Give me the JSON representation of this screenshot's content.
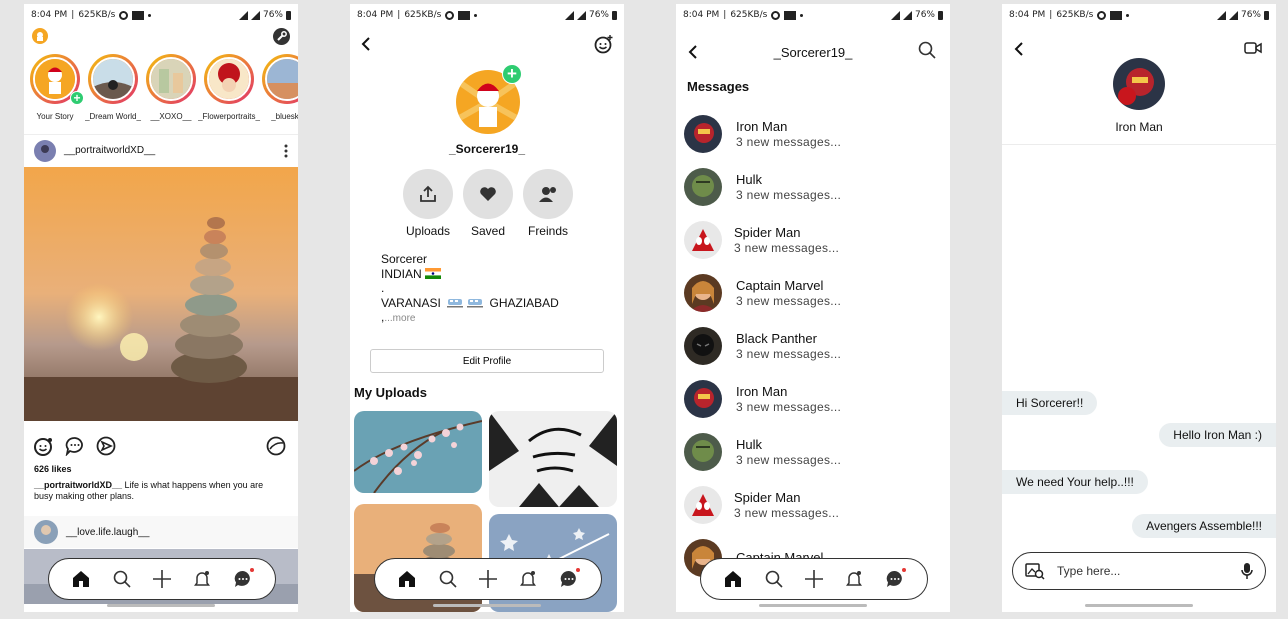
{
  "status_bar": {
    "time": "8:04 PM",
    "speed": "625KB/s",
    "battery": "76%"
  },
  "feed": {
    "stories": [
      {
        "name": "Your Story",
        "has_add": true
      },
      {
        "name": "_Dream World_"
      },
      {
        "name": "__XOXO__"
      },
      {
        "name": "_Flowerportraits_"
      },
      {
        "name": "_bluesky"
      }
    ],
    "post": {
      "username": "__portraitworldXD__",
      "likes": "626 likes",
      "caption_user": "__portraitworldXD__",
      "caption_text": " Life is what happens when you are busy making other plans."
    },
    "post2": {
      "username": "__love.life.laugh__"
    }
  },
  "profile": {
    "username": "_Sorcerer19_",
    "buttons": [
      {
        "label": "Uploads",
        "icon": "upload-icon"
      },
      {
        "label": "Saved",
        "icon": "heart-icon"
      },
      {
        "label": "Freinds",
        "icon": "friends-icon"
      }
    ],
    "bio": {
      "line1": "Sorcerer",
      "line2": "INDIAN",
      "line3": ".",
      "line4_a": "VARANASI",
      "line4_b": "GHAZIABAD",
      "line5": ",",
      "more": "...more"
    },
    "edit_label": "Edit Profile",
    "section_title": "My Uploads"
  },
  "messages": {
    "header": "_Sorcerer19_",
    "section_title": "Messages",
    "items": [
      {
        "name": "Iron Man",
        "preview": "3 new messages..."
      },
      {
        "name": "Hulk",
        "preview": "3 new messages..."
      },
      {
        "name": "Spider Man",
        "preview": "3 new messages..."
      },
      {
        "name": "Captain Marvel",
        "preview": "3 new messages..."
      },
      {
        "name": "Black Panther",
        "preview": "3 new messages..."
      },
      {
        "name": "Iron Man",
        "preview": "3 new messages..."
      },
      {
        "name": "Hulk",
        "preview": "3 new messages..."
      },
      {
        "name": "Spider Man",
        "preview": "3 new messages..."
      },
      {
        "name": "Captain Marvel",
        "preview": ""
      }
    ]
  },
  "chat": {
    "name": "Iron Man",
    "messages": [
      {
        "text": "Hi Sorcerer!!",
        "dir": "in"
      },
      {
        "text": "Hello Iron Man :)",
        "dir": "out"
      },
      {
        "text": "We need Your help..!!!",
        "dir": "in"
      },
      {
        "text": "Avengers Assemble!!!",
        "dir": "out"
      }
    ],
    "input_placeholder": "Type here..."
  },
  "colors": {
    "accent_green": "#2ecc71",
    "notification_red": "#e53935",
    "bubble_bg": "#e9eef0",
    "circle_btn_bg": "#e0e0e0"
  }
}
